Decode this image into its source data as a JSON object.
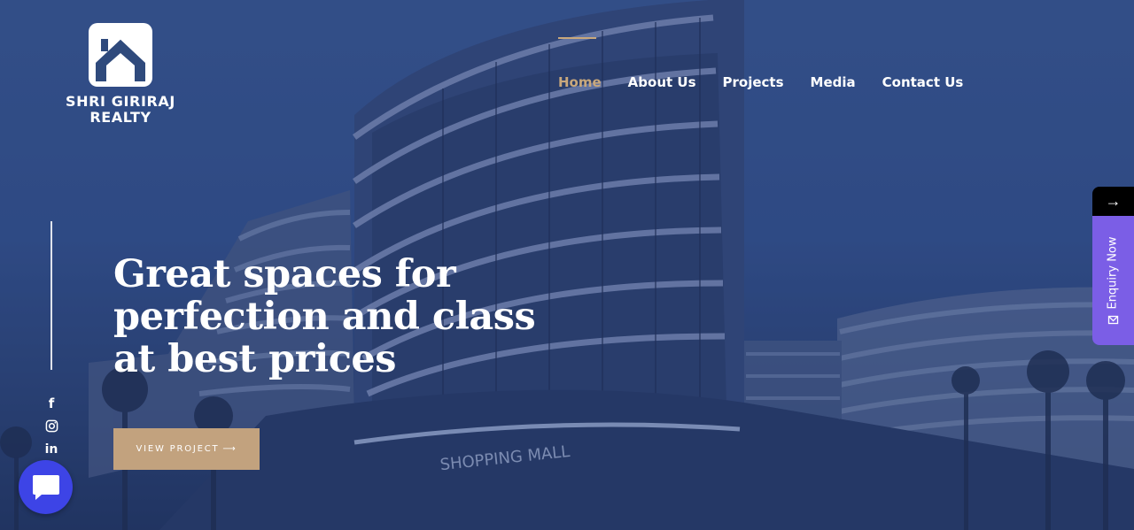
{
  "brand": {
    "line1": "SHRI GIRIRAJ",
    "line2": "REALTY",
    "logo_icon": "house-icon"
  },
  "nav": {
    "items": [
      {
        "label": "Home",
        "active": true
      },
      {
        "label": "About Us",
        "active": false
      },
      {
        "label": "Projects",
        "active": false
      },
      {
        "label": "Media",
        "active": false
      },
      {
        "label": "Contact Us",
        "active": false
      }
    ]
  },
  "hero": {
    "headline_lines": [
      "Great spaces for",
      "perfection and class",
      "at best prices"
    ],
    "cta_label": "VIEW PROJECT",
    "cta_arrow": "⟶",
    "building_sign": "SHOPPING MALL"
  },
  "social": [
    {
      "name": "facebook-icon",
      "glyph": "f"
    },
    {
      "name": "instagram-icon",
      "glyph": ""
    },
    {
      "name": "linkedin-icon",
      "glyph": "in"
    }
  ],
  "enquiry": {
    "arrow": "→",
    "label": "Enquiry Now",
    "icon": "mail-icon"
  },
  "chat": {
    "icon": "chat-bubble-icon"
  },
  "colors": {
    "accent": "#c2a27e",
    "nav_active": "#c9a87c",
    "enquiry_bg": "#7b5ee6",
    "chat_bg": "#3d44e6"
  }
}
